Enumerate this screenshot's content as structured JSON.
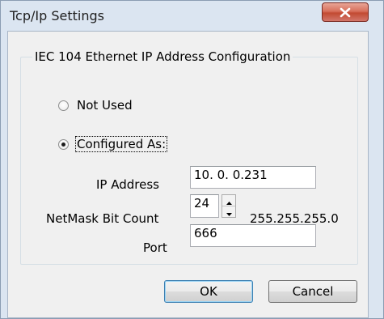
{
  "window": {
    "title": "Tcp/Ip Settings",
    "close_icon": "close-icon"
  },
  "group": {
    "legend": "IEC 104 Ethernet IP Address Configuration",
    "options": [
      {
        "label": "Not Used",
        "selected": false
      },
      {
        "label": "Configured As:",
        "selected": true
      }
    ]
  },
  "fields": {
    "ip_label": "IP Address",
    "ip_value": "10.  0.  0.231",
    "netmask_label": "NetMask Bit Count",
    "netmask_value": "24",
    "netmask_text": "255.255.255.0",
    "port_label": "Port",
    "port_value": "666"
  },
  "buttons": {
    "ok": "OK",
    "cancel": "Cancel"
  },
  "colors": {
    "frame": "#dbe5f1",
    "client": "#f0f0f0",
    "close_red": "#c24a32",
    "default_button_border": "#3c7fb1"
  }
}
